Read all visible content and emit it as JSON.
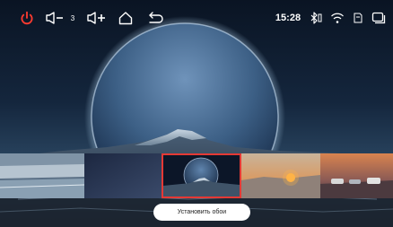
{
  "status_bar": {
    "volume_level": "3",
    "time": "15:28"
  },
  "icons": {
    "power": "power-icon",
    "volume_down": "volume-down-icon",
    "volume_up": "volume-up-icon",
    "home": "home-icon",
    "back": "back-icon",
    "bluetooth": "bluetooth-icon",
    "wifi": "wifi-icon",
    "sd_card": "sd-card-icon",
    "multi_window": "multi-window-icon"
  },
  "colors": {
    "power": "#ff3b30",
    "selected_border": "#e53935",
    "button_bg": "#ffffff"
  },
  "wallpapers": {
    "selected_index": 1,
    "items": [
      {
        "id": "dark-gradient",
        "scene": "dark blue gradient"
      },
      {
        "id": "planet-mountain",
        "scene": "planet over snowy mountain"
      },
      {
        "id": "desert-sunset",
        "scene": "desert with hot-air balloon"
      },
      {
        "id": "sunset-cars",
        "scene": "sunset with parked cars"
      }
    ]
  },
  "set_button": {
    "label": "Установить обои"
  }
}
